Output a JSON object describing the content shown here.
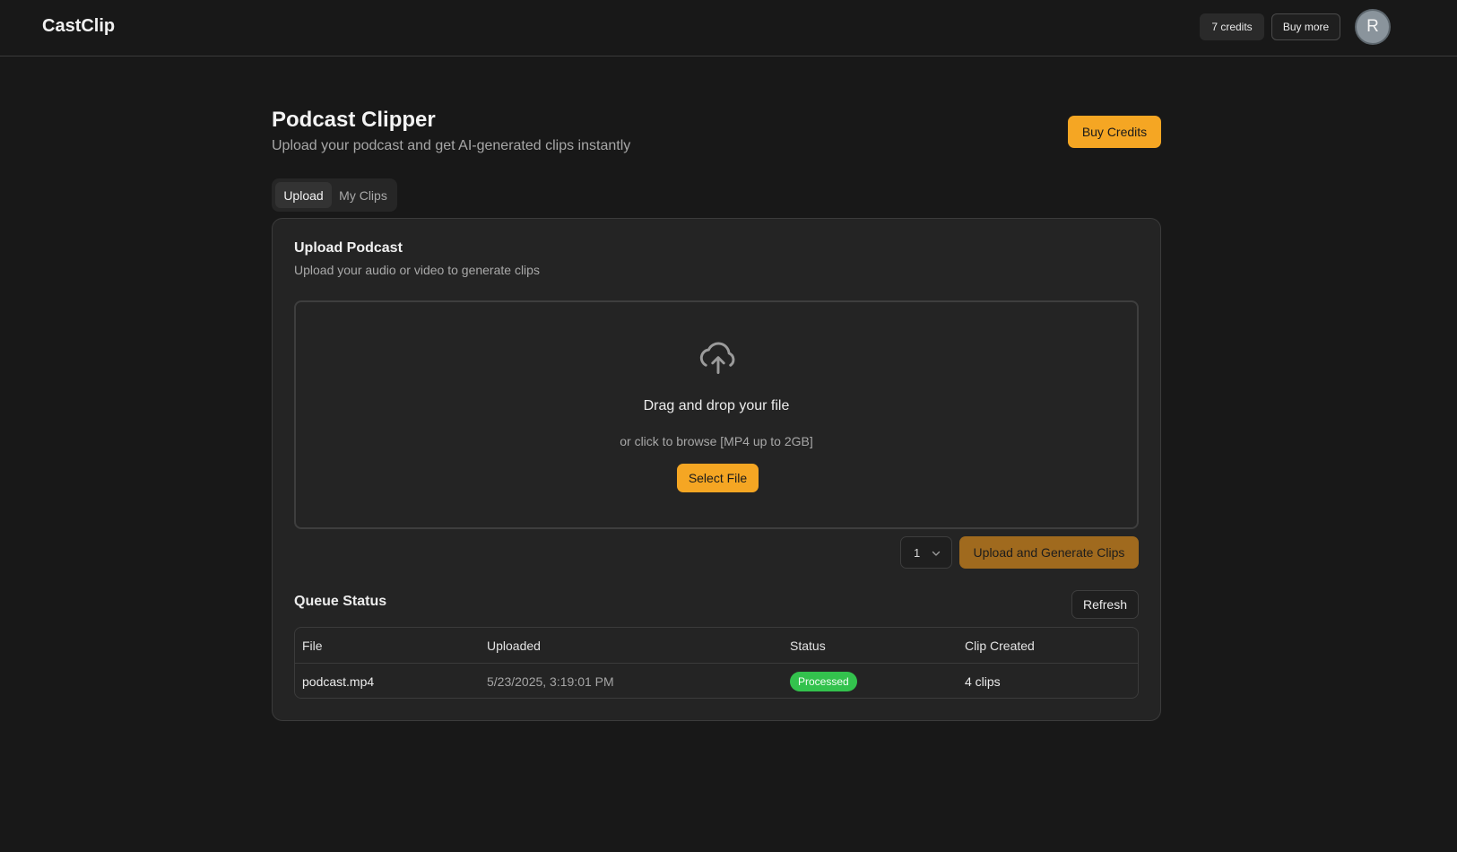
{
  "header": {
    "brand": "CastClip",
    "credits_label": "7 credits",
    "buy_more_label": "Buy more",
    "avatar_initial": "R"
  },
  "page": {
    "title": "Podcast Clipper",
    "subtitle": "Upload your podcast and get AI-generated clips instantly",
    "buy_credits_label": "Buy Credits"
  },
  "tabs": [
    {
      "label": "Upload",
      "active": true
    },
    {
      "label": "My Clips",
      "active": false
    }
  ],
  "upload_card": {
    "title": "Upload Podcast",
    "description": "Upload your audio or video to generate clips",
    "dropzone": {
      "icon": "cloud-upload-icon",
      "title": "Drag and drop your file",
      "hint": "or click to browse [MP4 up to 2GB]",
      "select_label": "Select File"
    },
    "clip_count": {
      "value": "1",
      "icon": "chevron-down-icon"
    },
    "generate_label": "Upload and Generate Clips"
  },
  "queue": {
    "title": "Queue Status",
    "refresh_label": "Refresh",
    "columns": [
      "File",
      "Uploaded",
      "Status",
      "Clip Created"
    ],
    "rows": [
      {
        "file": "podcast.mp4",
        "uploaded": "5/23/2025, 3:19:01 PM",
        "status": "Processed",
        "clips": "4 clips"
      }
    ]
  },
  "colors": {
    "background": "#181818",
    "card": "#242424",
    "accent": "#f5a623",
    "accent_muted": "#a06a1e",
    "status_success": "#33c24d"
  }
}
